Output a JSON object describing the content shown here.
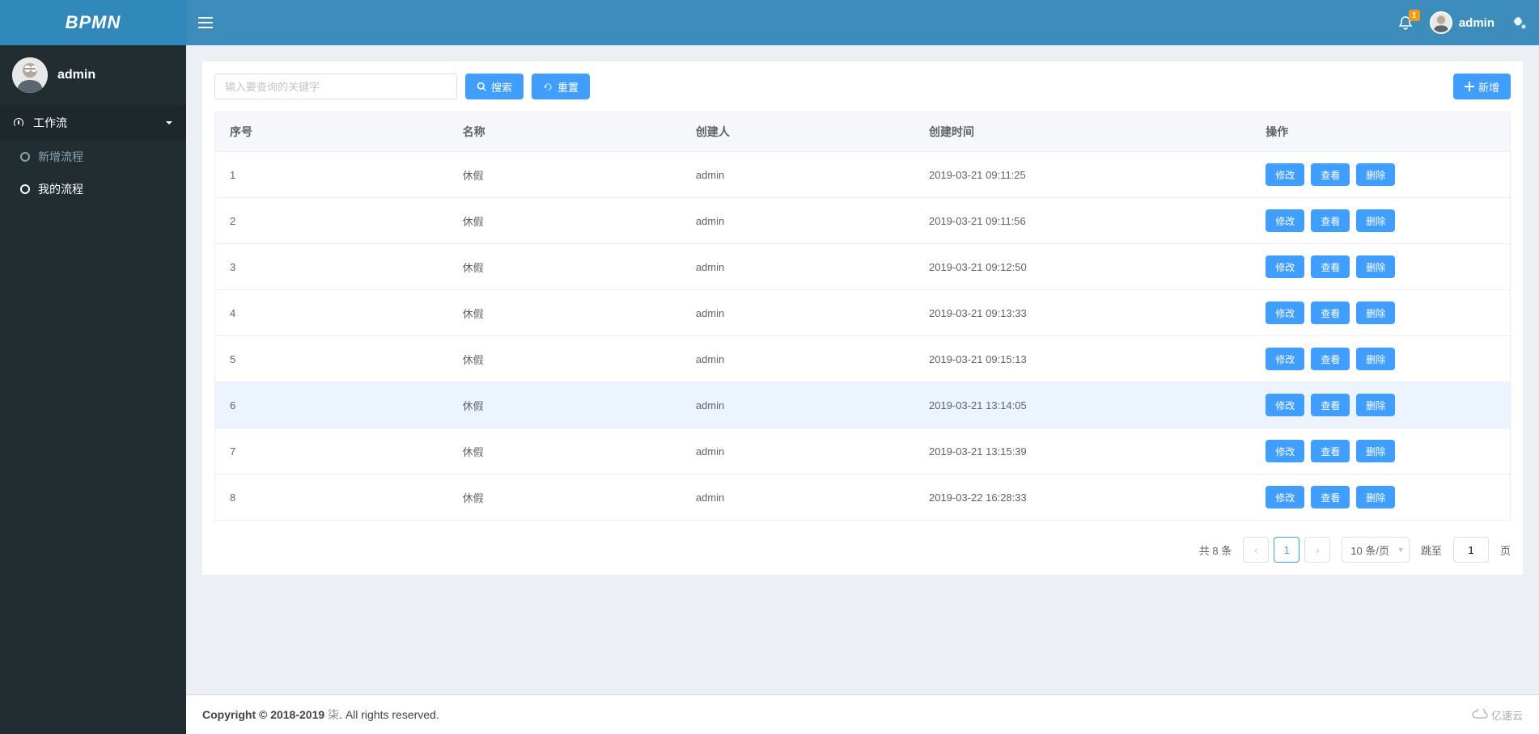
{
  "brand": "BPMN",
  "user": {
    "name": "admin"
  },
  "topbar": {
    "username": "admin",
    "badge": "1"
  },
  "sidebar": {
    "parent": {
      "label": "工作流"
    },
    "children": [
      {
        "label": "新增流程",
        "active": false
      },
      {
        "label": "我的流程",
        "active": true
      }
    ]
  },
  "toolbar": {
    "search_placeholder": "输入要查询的关键字",
    "search_btn": "搜索",
    "reset_btn": "重置",
    "add_btn": "新增"
  },
  "table": {
    "headers": [
      "序号",
      "名称",
      "创建人",
      "创建时间",
      "操作"
    ],
    "action_labels": {
      "edit": "修改",
      "view": "查看",
      "delete": "删除"
    },
    "rows": [
      {
        "seq": "1",
        "name": "休假",
        "creator": "admin",
        "created": "2019-03-21 09:11:25"
      },
      {
        "seq": "2",
        "name": "休假",
        "creator": "admin",
        "created": "2019-03-21 09:11:56"
      },
      {
        "seq": "3",
        "name": "休假",
        "creator": "admin",
        "created": "2019-03-21 09:12:50"
      },
      {
        "seq": "4",
        "name": "休假",
        "creator": "admin",
        "created": "2019-03-21 09:13:33"
      },
      {
        "seq": "5",
        "name": "休假",
        "creator": "admin",
        "created": "2019-03-21 09:15:13"
      },
      {
        "seq": "6",
        "name": "休假",
        "creator": "admin",
        "created": "2019-03-21 13:14:05",
        "hover": true
      },
      {
        "seq": "7",
        "name": "休假",
        "creator": "admin",
        "created": "2019-03-21 13:15:39"
      },
      {
        "seq": "8",
        "name": "休假",
        "creator": "admin",
        "created": "2019-03-22 16:28:33"
      }
    ]
  },
  "pagination": {
    "total_text": "共 8 条",
    "current": "1",
    "size_label": "10 条/页",
    "jump_label": "跳至",
    "jump_value": "1",
    "jump_suffix": "页"
  },
  "footer": {
    "copyright_bold": "Copyright © 2018-2019 ",
    "company": "柒",
    "rights": ". All rights reserved.",
    "watermark": "亿速云"
  }
}
